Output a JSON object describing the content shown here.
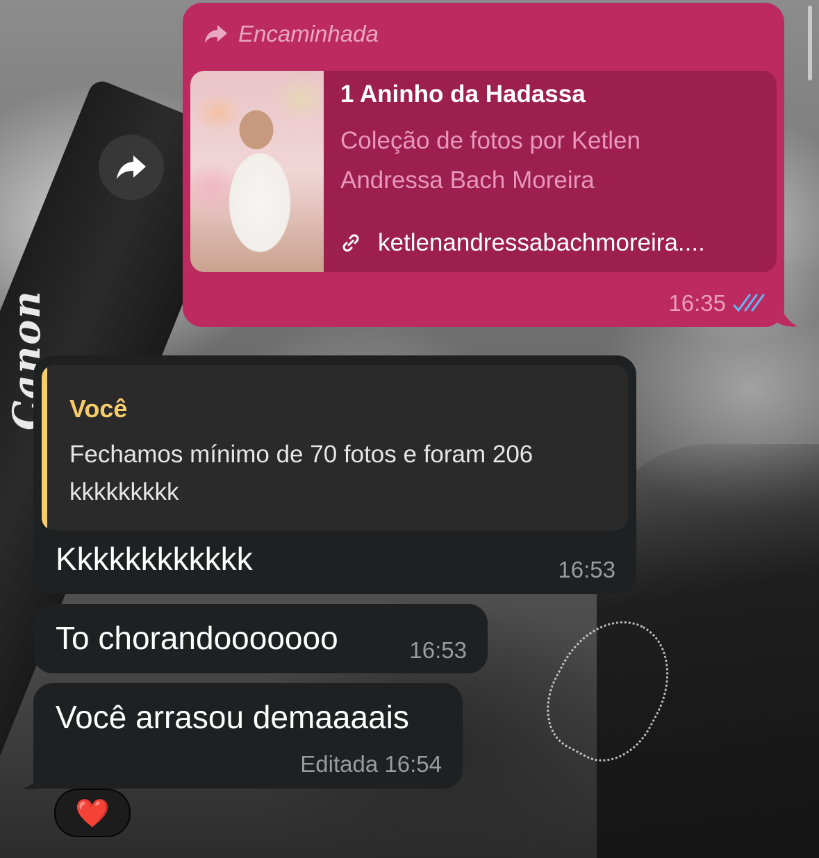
{
  "outgoing": {
    "forwarded_label": "Encaminhada",
    "link_card": {
      "title": "1 Aninho da Hadassa",
      "description": "Coleção de fotos por Ketlen Andressa Bach Moreira",
      "url": "ketlenandressabachmoreira...."
    },
    "time": "16:35",
    "status": "read",
    "colors": {
      "bubble": "#bd2a5f",
      "card": "#9c1f4d",
      "read_ticks": "#64b5f6"
    }
  },
  "incoming": {
    "quote": {
      "author": "Você",
      "text": "Fechamos mínimo de 70 fotos e foram 206 kkkkkkkkk",
      "accent_color": "#f7cd6b"
    },
    "messages": [
      {
        "text": "Kkkkkkkkkkkk",
        "time": "16:53"
      },
      {
        "text": "To chorandooooooo",
        "time": "16:53"
      },
      {
        "text": "Você arrasou demaaaais",
        "edited_label": "Editada",
        "time": "16:54"
      }
    ],
    "reaction": "❤️"
  },
  "wallpaper": {
    "strap_text": "Canon"
  },
  "icons": [
    "forward-arrow-icon",
    "share-icon",
    "link-icon",
    "double-check-icon"
  ]
}
